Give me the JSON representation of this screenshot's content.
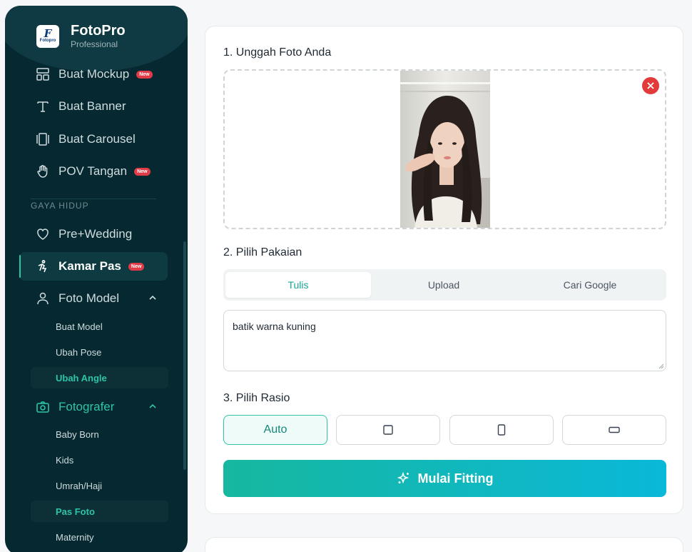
{
  "brand": {
    "name": "FotoPro",
    "subtitle": "Professional",
    "logo_letter": "F",
    "logo_text": "Fotopro"
  },
  "sidebar": {
    "items_top": [
      {
        "label": "Buat Mockup",
        "badge": "New",
        "icon": "layout-icon"
      },
      {
        "label": "Buat Banner",
        "icon": "text-icon"
      },
      {
        "label": "Buat Carousel",
        "icon": "carousel-icon"
      },
      {
        "label": "POV Tangan",
        "badge": "New",
        "icon": "hand-icon"
      }
    ],
    "section_label": "GAYA HIDUP",
    "items_life": [
      {
        "label": "Pre+Wedding",
        "icon": "heart-icon"
      },
      {
        "label": "Kamar Pas",
        "badge": "New",
        "icon": "fitting-icon"
      },
      {
        "label": "Foto Model",
        "icon": "user-icon"
      }
    ],
    "foto_model_sub": [
      "Buat Model",
      "Ubah Pose",
      "Ubah Angle"
    ],
    "fotografer_label": "Fotografer",
    "fotografer_sub": [
      "Baby Born",
      "Kids",
      "Umrah/Haji",
      "Pas Foto",
      "Maternity"
    ]
  },
  "main": {
    "step1_title": "1. Unggah Foto Anda",
    "step2_title": "2. Pilih Pakaian",
    "tabs": [
      "Tulis",
      "Upload",
      "Cari Google"
    ],
    "selected_tab": "Tulis",
    "prompt_value": "batik warna kuning",
    "step3_title": "3. Pilih Rasio",
    "ratio_auto": "Auto",
    "cta_label": "Mulai Fitting"
  },
  "colors": {
    "accent": "#2ec4a7",
    "sidebar_bg": "#062830",
    "badge": "#e23b48",
    "remove": "#e23b3b"
  }
}
